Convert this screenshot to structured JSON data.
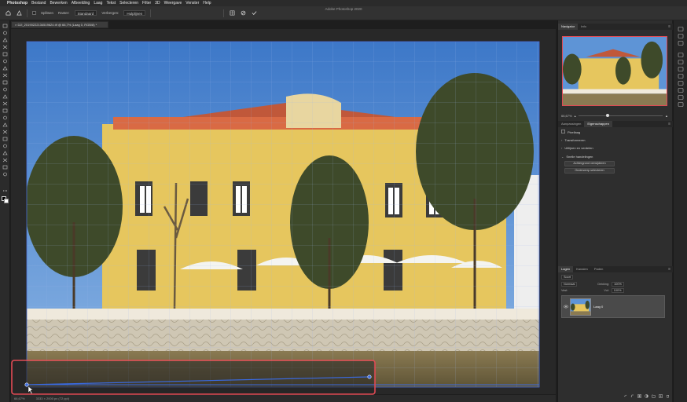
{
  "menubar": {
    "apple_glyph": "",
    "items": [
      "Photoshop",
      "Bestand",
      "Bewerken",
      "Afbeelding",
      "Laag",
      "Tekst",
      "Selecteren",
      "Filter",
      "3D",
      "Weergave",
      "Venster",
      "Help"
    ]
  },
  "app_title": "Adobe Photoshop 2020",
  "options": {
    "label_1": "Splitsen",
    "label_2": "Raster:",
    "field_2": "Standaard",
    "label_3": "Verbergen:",
    "field_3": "Hulplijnen"
  },
  "document": {
    "tab_label": "× DJI_20190222134519624.tif @ 66,7% (Laag 0, RGB/8) *"
  },
  "status": {
    "zoom": "66,67%",
    "doc_info": "3333 × 2000 px (72 ppi)"
  },
  "navigator": {
    "tabs": [
      "Navigator",
      "Info"
    ],
    "zoom": "66,67%",
    "zoom_level": 0.35
  },
  "properties": {
    "tabs": [
      "Aanpassingen",
      "Eigenschappen"
    ],
    "type_label": "Pixellaag",
    "sections": [
      "Transformeren",
      "Uitlijnen en verdelen",
      "Snelle handelingen"
    ],
    "actions": [
      "Achtergrond verwijderen",
      "Onderwerp selecteren"
    ]
  },
  "layers": {
    "tabs": [
      "Lagen",
      "Kanalen",
      "Paden"
    ],
    "kind_label": "Soort",
    "blend_mode": "Normaal",
    "opacity_label": "Dekking:",
    "opacity_value": "100%",
    "lock_label": "Vast:",
    "fill_label": "Vul:",
    "fill_value": "100%",
    "layer_name": "Laag 0"
  },
  "colors": {
    "highlight": "#e04a54",
    "panel_bg": "#2e2e2e",
    "active_layer": "#4a4a4a",
    "guide": "#3a6ae0"
  }
}
